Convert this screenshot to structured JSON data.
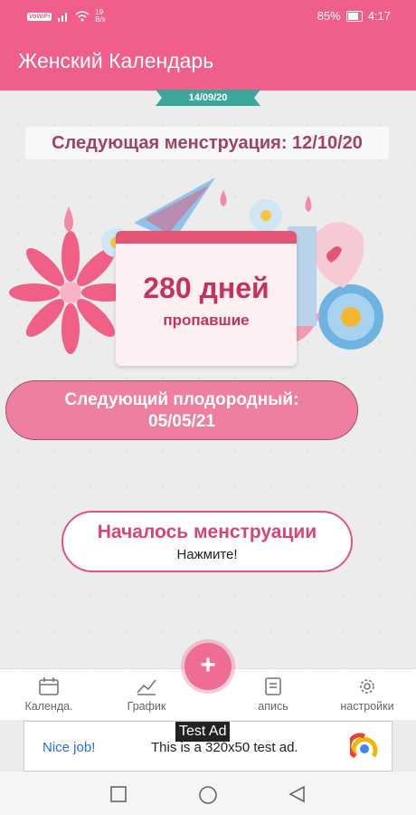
{
  "status_bar": {
    "carrier_badge": "VoWiFi",
    "net_speed_value": "19",
    "net_speed_unit": "B/s",
    "battery": "85%",
    "time": "4:17"
  },
  "app_bar": {
    "title": "Женский Календарь"
  },
  "date_ribbon": "14/09/20",
  "next_menstruation": "Следующая менструация: 12/10/20",
  "late_days": {
    "count_text": "280 дней",
    "label": "пропавшие"
  },
  "next_fertile": {
    "line1": "Следующий плодородный:",
    "line2": "05/05/21"
  },
  "start_button": {
    "title": "Началось менструации",
    "subtitle": "Нажмите!"
  },
  "fab_label": "+",
  "bottom_nav": [
    {
      "label": "Календа.",
      "icon": "calendar-icon"
    },
    {
      "label": "График",
      "icon": "chart-icon"
    },
    {
      "label": "апись",
      "icon": "note-icon"
    },
    {
      "label": "настройки",
      "icon": "gear-icon"
    }
  ],
  "ad": {
    "label": "Test Ad",
    "nice": "Nice job!",
    "message": "This is a 320x50 test ad."
  },
  "colors": {
    "brand_pink": "#f05f8c",
    "fertile_pink": "#ef7fa0",
    "ribbon_teal": "#3aa79a",
    "text_rose": "#a0445d"
  }
}
